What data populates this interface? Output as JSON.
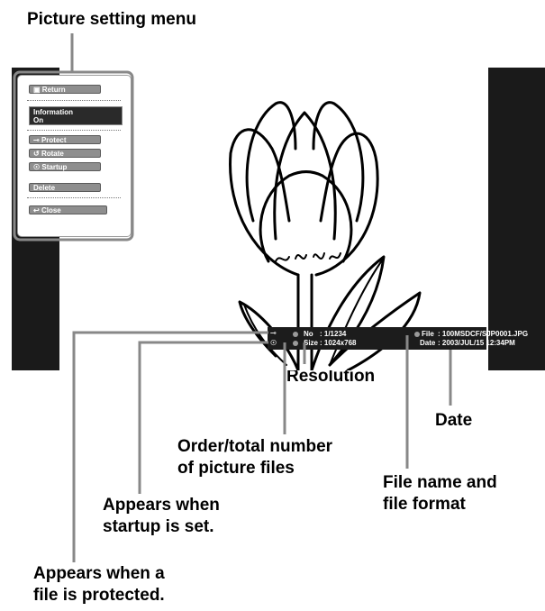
{
  "callouts": {
    "menu_title": "Picture setting menu",
    "resolution": "Resolution",
    "date": "Date",
    "order_line1": "Order/total number",
    "order_line2": "of picture files",
    "filename_line1": "File name and",
    "filename_line2": "file format",
    "startup_line1": "Appears when",
    "startup_line2": "startup is set.",
    "protect_line1": "Appears when a",
    "protect_line2": "file is protected."
  },
  "menu": {
    "return_label": "Return",
    "information_label": "Information",
    "information_value": "On",
    "protect_label": "Protect",
    "rotate_label": "Rotate",
    "startup_label": "Startup",
    "delete_label": "Delete",
    "close_label": "Close"
  },
  "info_bar": {
    "no_label": "No",
    "no_value": ": 1/1234",
    "size_label": "Size",
    "size_value": ": 1024x768",
    "file_label": "File",
    "file_value": ": 100MSDCF/SJP0001.JPG",
    "date_label": "Date",
    "date_value": ": 2003/JUL/15 12:34PM"
  },
  "icons": {
    "protect": "key-icon",
    "startup": "startup-icon",
    "return": "lock-icon",
    "rotate": "rotate-icon",
    "close": "back-arrow-icon"
  },
  "colors": {
    "screen": "#1a1a1a",
    "callout_line": "#888888",
    "button": "#8e8e8e"
  }
}
